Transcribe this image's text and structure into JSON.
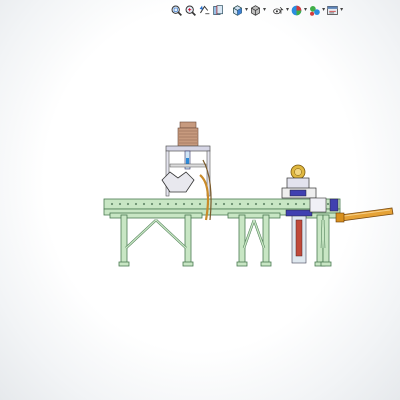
{
  "toolbar": {
    "items": [
      {
        "icon": "zoom-to-fit-icon",
        "has_menu": false
      },
      {
        "icon": "zoom-to-area-icon",
        "has_menu": false
      },
      {
        "icon": "previous-view-icon",
        "has_menu": false
      },
      {
        "icon": "section-view-icon",
        "has_menu": false
      },
      {
        "icon": "view-orientation-icon",
        "has_menu": true
      },
      {
        "icon": "display-style-icon",
        "has_menu": true
      },
      {
        "icon": "hide-show-items-icon",
        "has_menu": true
      },
      {
        "icon": "edit-appearance-icon",
        "has_menu": true
      },
      {
        "icon": "apply-scene-icon",
        "has_menu": true
      },
      {
        "icon": "view-settings-icon",
        "has_menu": true
      }
    ]
  },
  "model": {
    "description_icon": "conveyor-assembly-model",
    "colors": {
      "frame": "#c8e6c4",
      "frame_stroke": "#4a7a52",
      "motor": "#c79a7e",
      "gear": "#e0b840",
      "cylinder": "#e5a236",
      "blue_part": "#4040b0",
      "red_part": "#c04a3a",
      "blue_pin": "#2a8ad8"
    }
  }
}
